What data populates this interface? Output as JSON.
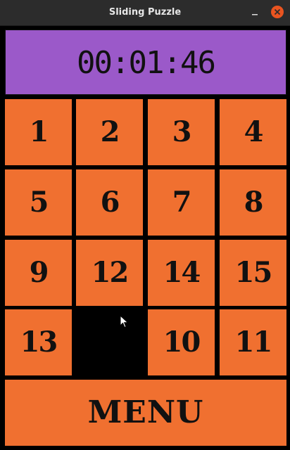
{
  "window": {
    "title": "Sliding Puzzle",
    "minimize_icon": "minimize-icon",
    "close_icon": "close-icon"
  },
  "timer": {
    "value": "00:01:46"
  },
  "board": {
    "rows": [
      [
        "1",
        "2",
        "3",
        "4"
      ],
      [
        "5",
        "6",
        "7",
        "8"
      ],
      [
        "9",
        "12",
        "14",
        "15"
      ],
      [
        "13",
        "",
        "10",
        "11"
      ]
    ],
    "empty_cell": {
      "row": 4,
      "column": 2
    }
  },
  "menu": {
    "label": "MENU"
  },
  "colors": {
    "tile": "#f07030",
    "timer": "#9b59c9",
    "background": "#000000",
    "close_button": "#e95420"
  }
}
